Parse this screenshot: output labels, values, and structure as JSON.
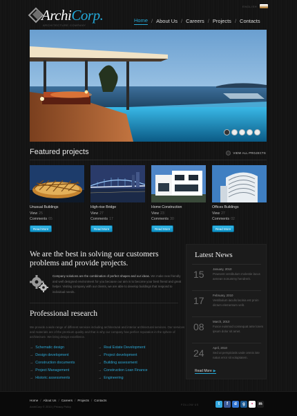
{
  "brand": {
    "name_main": "Archi",
    "name_accent": "Corp.",
    "tagline": "ARCHITECTURE COMPANY"
  },
  "top_bar": {
    "label": "ENGLISH"
  },
  "nav": [
    "Home",
    "About Us",
    "Careers",
    "Projects",
    "Contacts"
  ],
  "hero": {
    "slides": 5,
    "active_slide": 0
  },
  "featured": {
    "title": "Featured projects",
    "view_all": "VIEW ALL PROJECTS",
    "projects": [
      {
        "name": "Unusual Buildings",
        "view_label": "View",
        "view_count": "25",
        "comments_label": "Comments",
        "comments_count": "65",
        "button": "Read More",
        "thumb": "stadium"
      },
      {
        "name": "High-rise Bridge",
        "view_label": "View",
        "view_count": "27",
        "comments_label": "Comments",
        "comments_count": "17",
        "button": "Read More",
        "thumb": "bridge"
      },
      {
        "name": "Home Construction",
        "view_label": "View",
        "view_count": "23",
        "comments_label": "Comments",
        "comments_count": "30",
        "button": "Read More",
        "thumb": "house"
      },
      {
        "name": "Offices Buildings",
        "view_label": "View",
        "view_count": "27",
        "comments_label": "Comments",
        "comments_count": "02",
        "button": "Read More",
        "thumb": "tower"
      }
    ]
  },
  "about": {
    "title": "We are the best in solving our customers problems and provide projects.",
    "lead": "Company solutions are the combination of perfect shapes and our ideas.",
    "text": "We make new friendly and well designed environment for you because our aim is to become your best friend and great helper. Visiting company with our clients, we are able to develop buildings that respond to individual needs."
  },
  "research": {
    "title": "Professional research",
    "text": "We provide a wide range of different services including architectural and interior architectural services. Our services and materials are of the premium quality and that is why our company has perfect reputation in the sphere of architecture. We bring design excellence.",
    "links_left": [
      "Schematic design",
      "Design development",
      "Construction documents",
      "Project Management",
      "Historic assessments"
    ],
    "links_right": [
      "Real Estate Development",
      "Project development",
      "Building assessment",
      "Construction Loan Finance",
      "Engineering"
    ]
  },
  "news": {
    "title": "Latest News",
    "items": [
      {
        "day": "15",
        "date": "January, 2010",
        "text": "Praesent vestibulum molestie lacus aenean nonummy hendrerit."
      },
      {
        "day": "17",
        "date": "February, 2010",
        "text": "Vestibulum iaculis lacinia est proin dictum elementum velit."
      },
      {
        "day": "08",
        "date": "March, 2010",
        "text": "Fusce euismod consequat ante lorem ipsum dolor sit amet."
      },
      {
        "day": "24",
        "date": "April, 2010",
        "text": "Sed ut perspiciatis unde omnis iste natus error sit voluptatem."
      }
    ],
    "read_more": "Read More"
  },
  "footer": {
    "nav": [
      "Home",
      "About Us",
      "Careers",
      "Projects",
      "Contacts"
    ],
    "copyright": "ArchiCorp © 2010 | Privacy Policy",
    "label": "FOLLOW US",
    "socials": [
      {
        "name": "twitter",
        "color": "#33a8e0",
        "glyph": "t"
      },
      {
        "name": "facebook",
        "color": "#3b5998",
        "glyph": "f"
      },
      {
        "name": "delicious",
        "color": "#3274d1",
        "glyph": "d"
      },
      {
        "name": "digg",
        "color": "#1b5891",
        "glyph": "g"
      },
      {
        "name": "flickr",
        "color": "#fefefe",
        "glyph": "•"
      },
      {
        "name": "myspace",
        "color": "#1d1d1d",
        "glyph": "m"
      }
    ]
  }
}
